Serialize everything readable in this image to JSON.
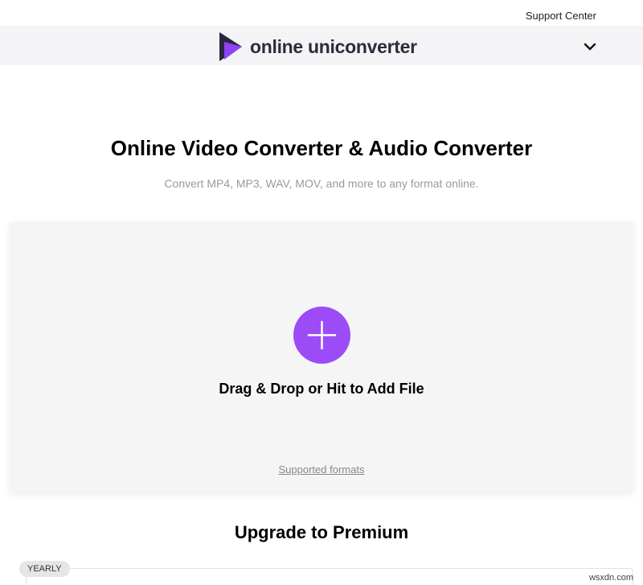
{
  "topbar": {
    "support_label": "Support Center"
  },
  "header": {
    "brand_name": "online uniconverter",
    "logo_colors": {
      "dark": "#2a2640",
      "purple": "#8e44f0"
    },
    "menu_icon": "chevron-down-icon"
  },
  "hero": {
    "title": "Online Video Converter & Audio Converter",
    "subtitle": "Convert MP4, MP3, WAV, MOV, and more to any format online."
  },
  "dropzone": {
    "add_icon": "plus-icon",
    "accent_color": "#9b4cf7",
    "drop_label": "Drag & Drop or Hit to Add File",
    "formats_link": "Supported formats"
  },
  "premium": {
    "title": "Upgrade to Premium",
    "plan_tab": "YEARLY"
  },
  "watermark": "wsxdn.com"
}
